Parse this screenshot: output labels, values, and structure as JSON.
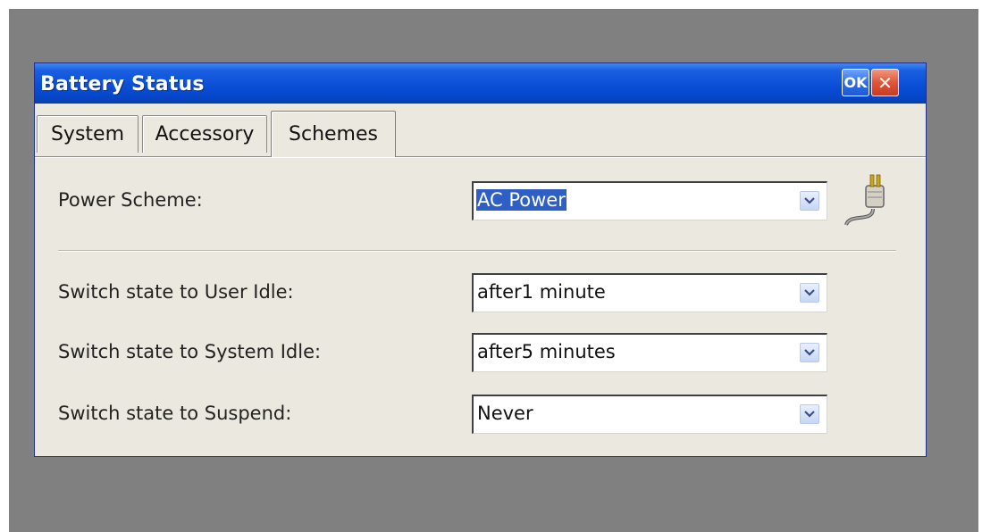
{
  "window": {
    "title": "Battery Status",
    "ok_label": "OK",
    "close_label": "✕"
  },
  "tabs": [
    {
      "label": "System",
      "active": false
    },
    {
      "label": "Accessory",
      "active": false
    },
    {
      "label": "Schemes",
      "active": true
    }
  ],
  "settings": {
    "power_scheme": {
      "label": "Power Scheme:",
      "value": "AC Power",
      "icon": "power-plug-icon"
    },
    "user_idle": {
      "label": "Switch state to User Idle:",
      "value": "after1 minute"
    },
    "system_idle": {
      "label": "Switch state to System Idle:",
      "value": "after5 minutes"
    },
    "suspend": {
      "label": "Switch state to Suspend:",
      "value": "Never"
    }
  },
  "colors": {
    "titlebar": "#0a4fd6",
    "selection": "#2d5fc4",
    "window_bg": "#ebe9df",
    "desktop_bg": "#808080",
    "close_button": "#e0553a"
  }
}
